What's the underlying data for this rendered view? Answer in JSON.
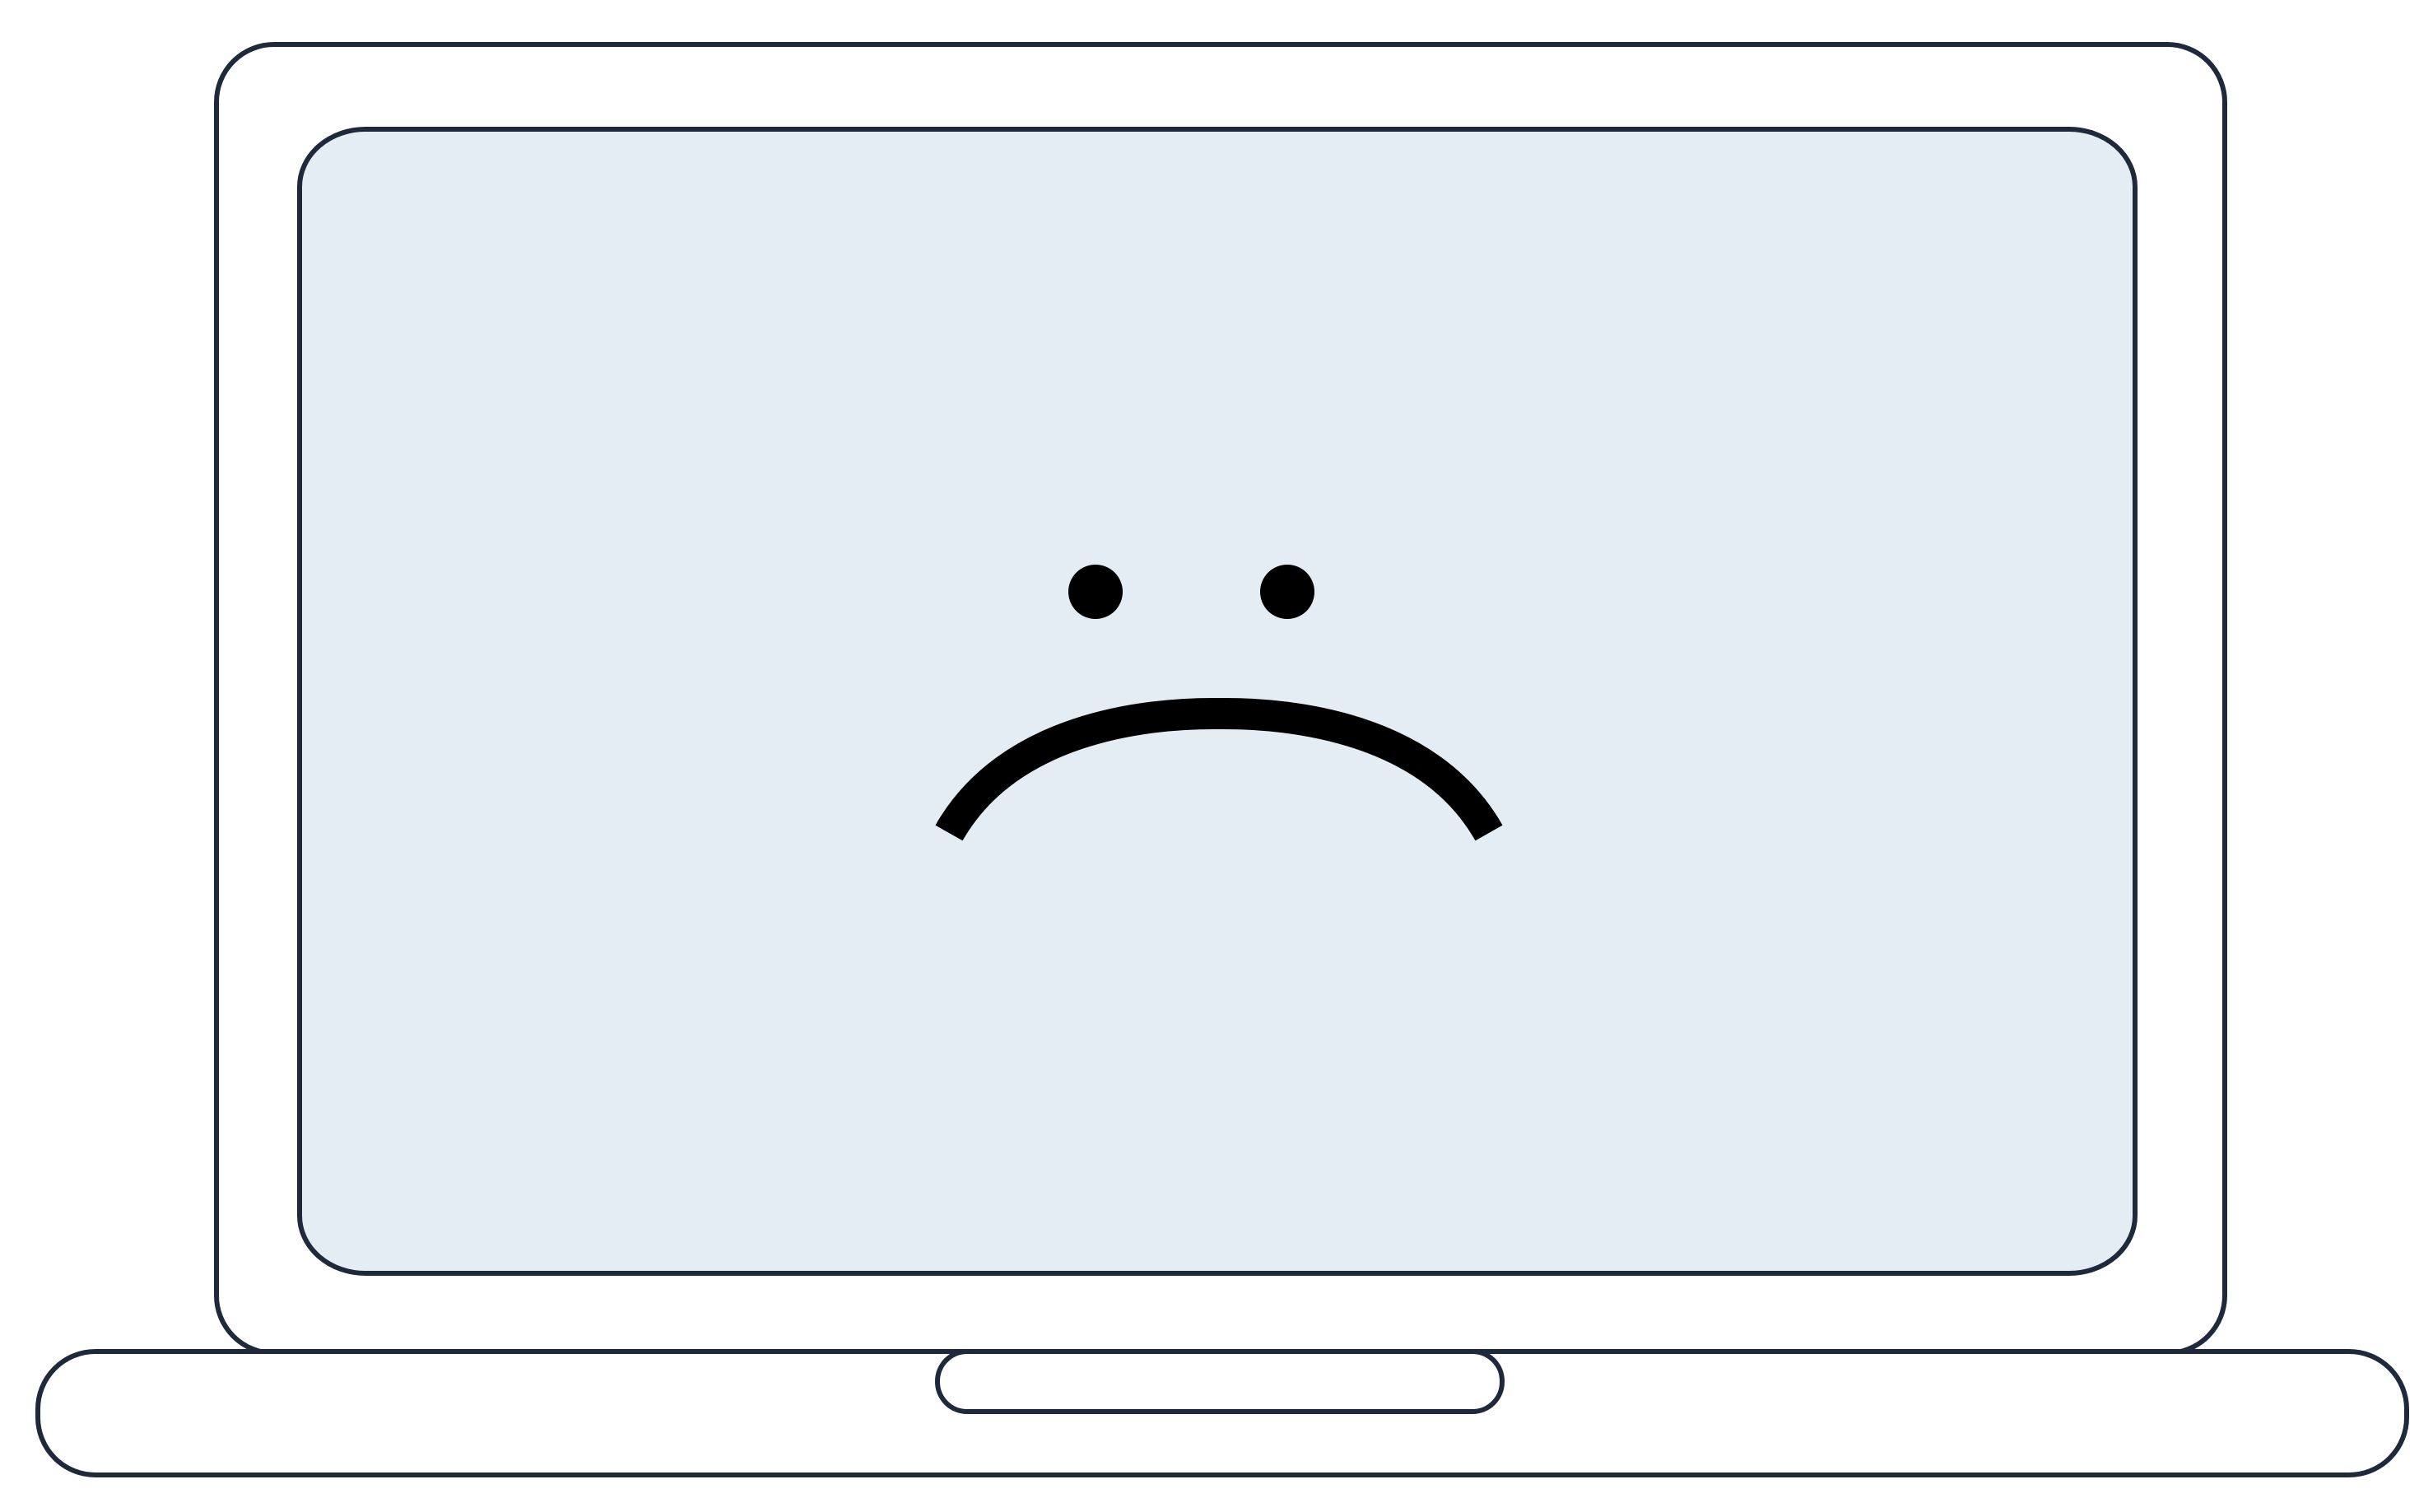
{
  "illustration": {
    "subject": "laptop-with-sad-face",
    "colors": {
      "background": "#ffffff",
      "outline": "#1e293b",
      "screen": "#e4ecf4",
      "body": "#ffffff",
      "face": "#000000"
    }
  }
}
